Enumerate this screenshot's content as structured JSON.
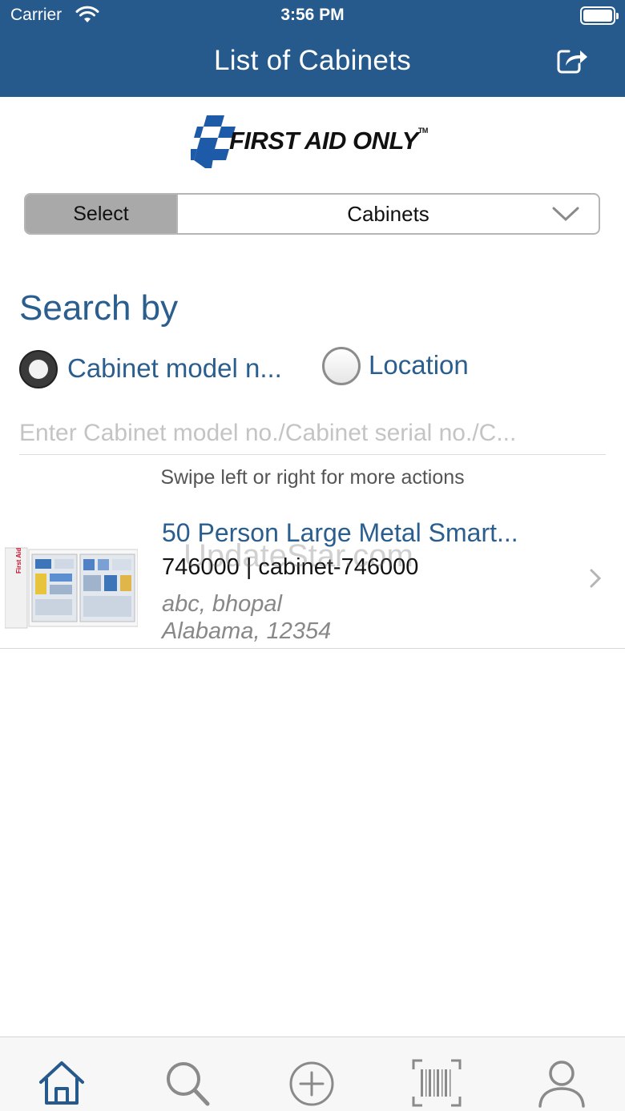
{
  "status_bar": {
    "carrier": "Carrier",
    "time": "3:56 PM"
  },
  "nav": {
    "title": "List of Cabinets",
    "share_icon": "share-icon"
  },
  "logo": {
    "text": "FIRST AID ONLY",
    "tm": "TM",
    "brand_blue": "#1d5aa8"
  },
  "selector": {
    "label": "Select",
    "value": "Cabinets"
  },
  "search": {
    "heading": "Search by",
    "options": [
      {
        "label": "Cabinet model n...",
        "selected": true
      },
      {
        "label": "Location",
        "selected": false
      }
    ],
    "placeholder": "Enter Cabinet model no./Cabinet serial no./C..."
  },
  "hint": "Swipe left or right for more actions",
  "cabinets": [
    {
      "title": "50 Person Large Metal Smart...",
      "subtitle": "746000 | cabinet-746000",
      "location_line1": "abc, bhopal",
      "location_line2": "Alabama, 12354"
    }
  ],
  "watermark": "UpdateStar.com",
  "tabs": [
    {
      "name": "home",
      "icon": "home-icon",
      "active": true
    },
    {
      "name": "search",
      "icon": "search-icon",
      "active": false
    },
    {
      "name": "add",
      "icon": "plus-circle-icon",
      "active": false
    },
    {
      "name": "scan",
      "icon": "barcode-scan-icon",
      "active": false
    },
    {
      "name": "profile",
      "icon": "user-icon",
      "active": false
    }
  ],
  "colors": {
    "nav_bg": "#265a8c",
    "accent": "#2a5e8e",
    "active_tab": "#265a8c",
    "inactive_tab": "#8a8a8a"
  }
}
